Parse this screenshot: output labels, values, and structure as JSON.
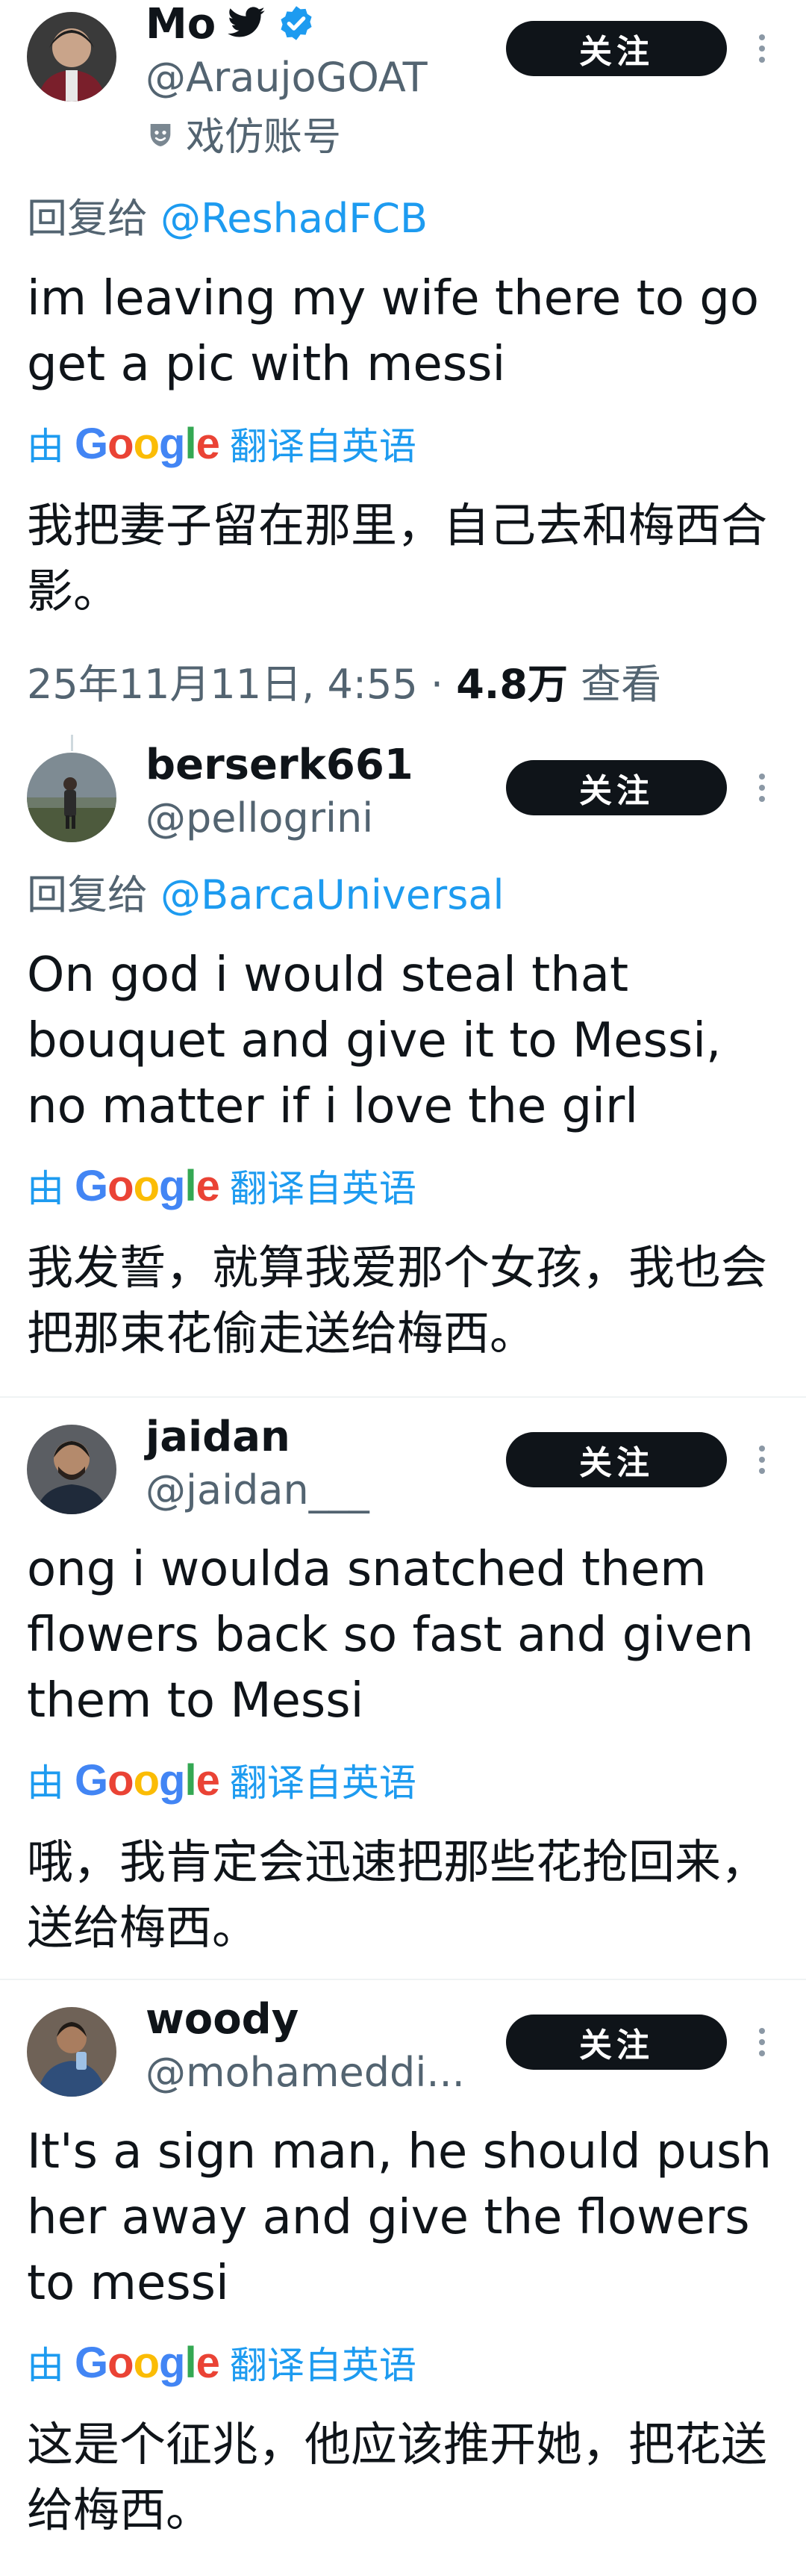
{
  "follow_label": "关注",
  "translate": {
    "by": "由",
    "google": "Google",
    "label": "翻译自英语"
  },
  "posts": [
    {
      "name": "Mo",
      "handle": "@AraujoGOAT",
      "parody_label": "戏仿账号",
      "reply_prefix": "回复给",
      "reply_to": "@ReshadFCB",
      "text": "im leaving my wife there to go get a pic with messi",
      "translation": "我把妻子留在那里，自己去和梅西合影。",
      "date": "25年11月11日, 4:55 · ",
      "views": "4.8万",
      "views_label": " 查看"
    },
    {
      "name": "berserk661",
      "handle": "@pellogrini",
      "reply_prefix": "回复给",
      "reply_to": "@BarcaUniversal",
      "text": "On god i would steal that bouquet and give it to Messi, no matter if i love the girl",
      "translation": "我发誓，就算我爱那个女孩，我也会把那束花偷走送给梅西。"
    },
    {
      "name": "jaidan",
      "handle": "@jaidan___",
      "text": "ong i woulda snatched them flowers back so fast and given them to Messi",
      "translation": "哦，我肯定会迅速把那些花抢回来，送给梅西。"
    },
    {
      "name": "woody",
      "handle": "@mohameddi...",
      "text": "It's a sign man, he should push her away and give the flowers to messi",
      "translation": "这是个征兆，他应该推开她，把花送给梅西。"
    }
  ],
  "colors": {
    "text": "#0f1419",
    "secondary": "#536471",
    "link": "#1d9bf0",
    "verified": "#1d9bf0",
    "button_bg": "#0f1419",
    "divider": "#eff3f4"
  }
}
